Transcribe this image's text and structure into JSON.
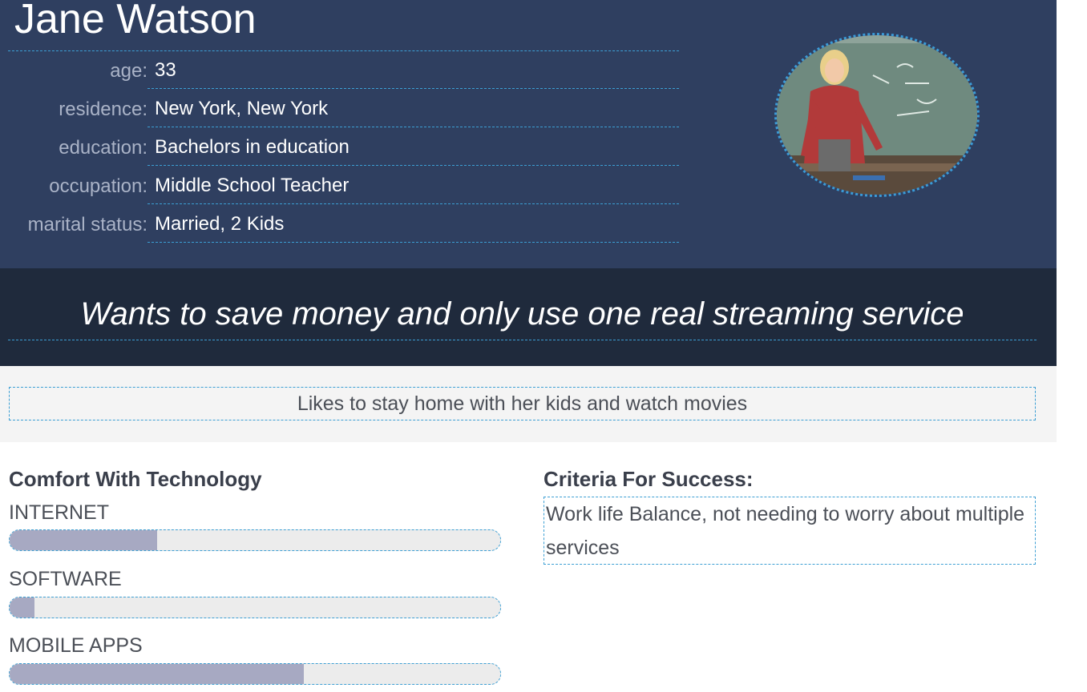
{
  "persona": {
    "name": "Jane Watson",
    "fields": [
      {
        "label": "age:",
        "value": "33"
      },
      {
        "label": "residence:",
        "value": "New York, New York"
      },
      {
        "label": "education:",
        "value": "Bachelors in education"
      },
      {
        "label": "occupation:",
        "value": "Middle School Teacher"
      },
      {
        "label": "marital status:",
        "value": "Married, 2 Kids"
      }
    ],
    "photo_alt": "teacher-photo"
  },
  "goal": "Wants to save money and only use one real streaming service",
  "likes": "Likes to stay home with her kids and watch movies",
  "technology": {
    "title": "Comfort With Technology",
    "meters": [
      {
        "label": "INTERNET",
        "level": 0.3
      },
      {
        "label": "SOFTWARE",
        "level": 0.05
      },
      {
        "label": "MOBILE APPS",
        "level": 0.6
      }
    ]
  },
  "criteria": {
    "title": "Criteria For Success:",
    "text": "Work life Balance, not needing to worry about multiple services"
  },
  "colors": {
    "header_bg": "#2f3f60",
    "quote_bg": "#1f2a3c",
    "accent_dashed": "#3c9fd4",
    "meter_fill": "#a7a9c2",
    "meter_track": "#ececec"
  }
}
